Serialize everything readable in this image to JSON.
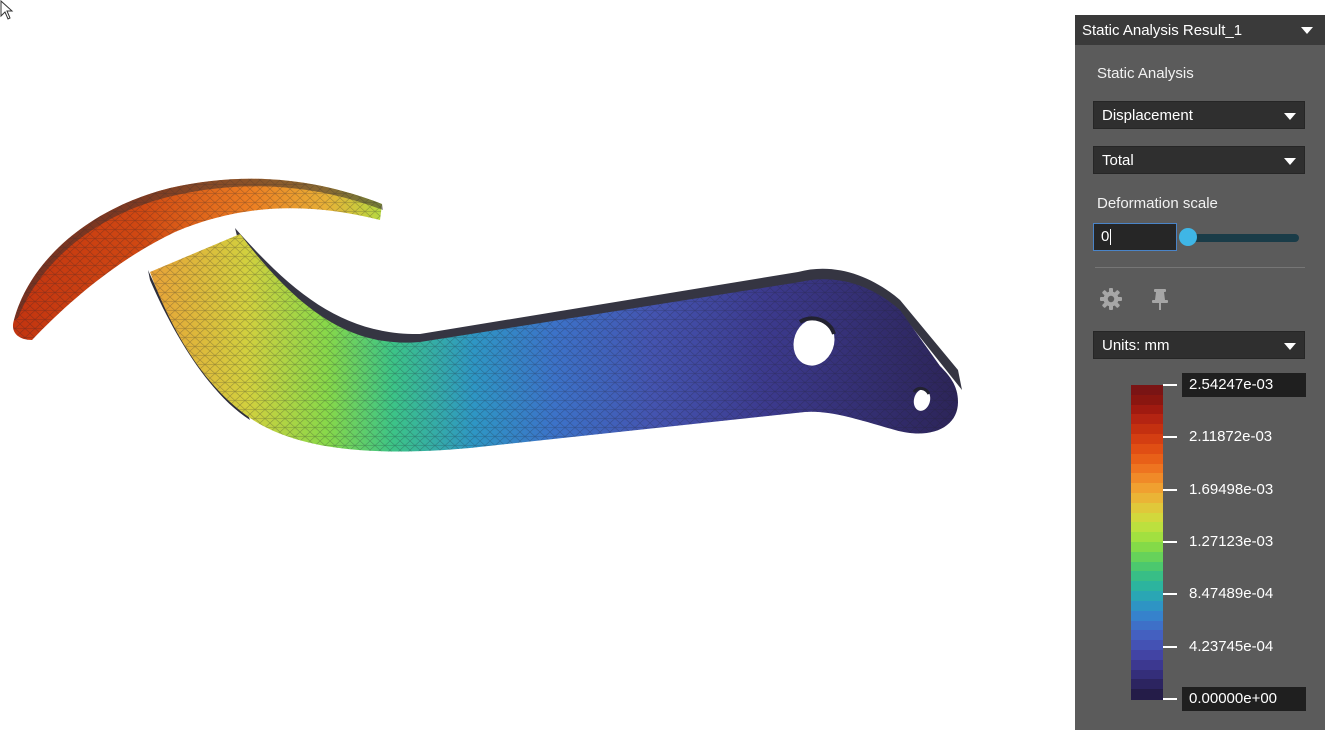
{
  "panel": {
    "title": "Static Analysis Result_1",
    "analysis_label": "Static Analysis",
    "result_type": "Displacement",
    "component": "Total",
    "deformation_label": "Deformation scale",
    "deformation_value": "0",
    "deformation_slider_value": 0,
    "units": "Units: mm"
  },
  "legend": {
    "max": "2.54247e-03",
    "min": "0.00000e+00",
    "ticks": [
      "2.11872e-03",
      "1.69498e-03",
      "1.27123e-03",
      "8.47489e-04",
      "4.23745e-04"
    ],
    "colors": [
      "#7a1414",
      "#8a1610",
      "#a01a10",
      "#b42412",
      "#c43010",
      "#d43e12",
      "#e04e14",
      "#e86018",
      "#ee7420",
      "#f08a28",
      "#f0a030",
      "#eab436",
      "#e0c83a",
      "#d2d83c",
      "#bce03e",
      "#a2e040",
      "#84da48",
      "#66d25a",
      "#4cc86e",
      "#38be86",
      "#2cb49e",
      "#2aa6b4",
      "#2e94c4",
      "#3682cc",
      "#3e70c8",
      "#4460c0",
      "#4452b4",
      "#4244a4",
      "#3c3890",
      "#342e7a",
      "#2c2460",
      "#241c48"
    ]
  },
  "colors": {
    "panel_bg": "#5b5b5b",
    "header_bg": "#3a3a3a",
    "slider_accent": "#3fb6e6"
  },
  "icons": [
    "gear-icon",
    "pin-icon",
    "dropdown-caret-icon",
    "mouse-cursor-icon"
  ]
}
